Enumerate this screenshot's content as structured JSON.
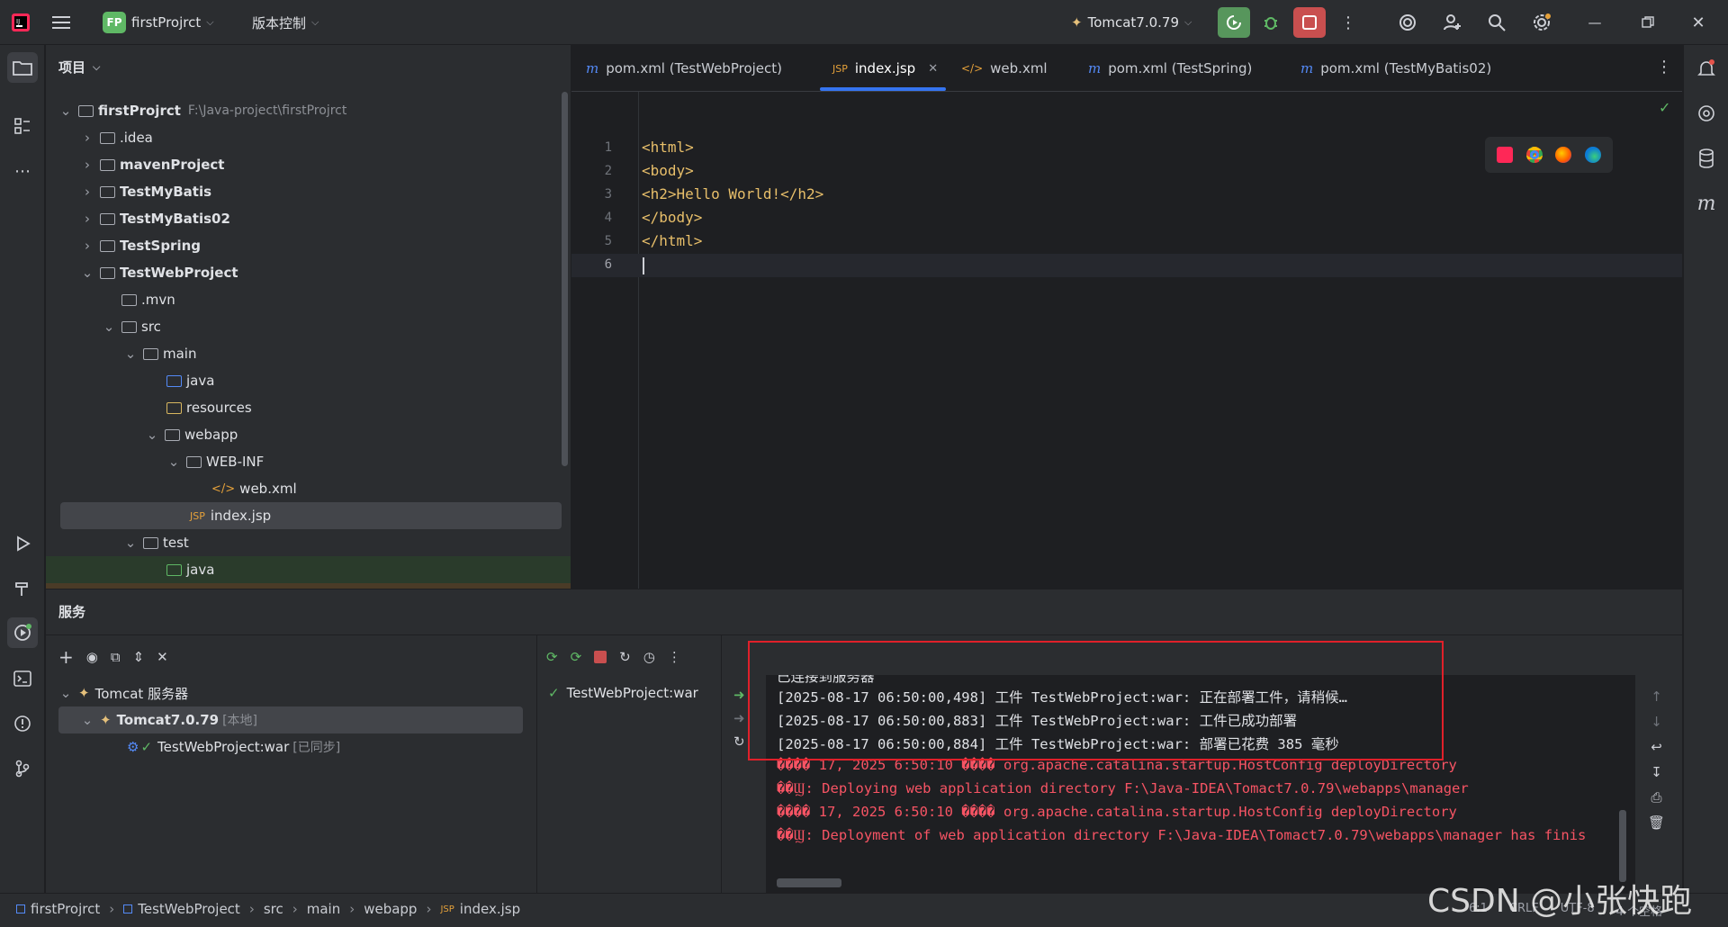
{
  "titlebar": {
    "project_badge": "FP",
    "project_name": "firstProjrct",
    "vcs_menu": "版本控制",
    "run_config": "Tomcat7.0.79"
  },
  "project_panel": {
    "title": "项目",
    "rows": [
      {
        "label": "firstProjrct",
        "path": "F:\\Java-project\\firstProjrct"
      },
      {
        "label": ".idea"
      },
      {
        "label": "mavenProject"
      },
      {
        "label": "TestMyBatis"
      },
      {
        "label": "TestMyBatis02"
      },
      {
        "label": "TestSpring"
      },
      {
        "label": "TestWebProject"
      },
      {
        "label": ".mvn"
      },
      {
        "label": "src"
      },
      {
        "label": "main"
      },
      {
        "label": "java"
      },
      {
        "label": "resources"
      },
      {
        "label": "webapp"
      },
      {
        "label": "WEB-INF"
      },
      {
        "label": "web.xml"
      },
      {
        "label": "index.jsp"
      },
      {
        "label": "test"
      },
      {
        "label": "java"
      }
    ]
  },
  "editor": {
    "tabs": [
      {
        "label": "pom.xml (TestWebProject)"
      },
      {
        "label": "index.jsp"
      },
      {
        "label": "web.xml"
      },
      {
        "label": "pom.xml (TestSpring)"
      },
      {
        "label": "pom.xml (TestMyBatis02)"
      }
    ],
    "lines": [
      {
        "n": "1",
        "code": "<html>"
      },
      {
        "n": "2",
        "code": "<body>"
      },
      {
        "n": "3",
        "code": "<h2>Hello World!</h2>"
      },
      {
        "n": "4",
        "code": "</body>"
      },
      {
        "n": "5",
        "code": "</html>"
      },
      {
        "n": "6",
        "code": ""
      }
    ]
  },
  "services": {
    "title": "服务",
    "tree": {
      "root": "Tomcat 服务器",
      "server": "Tomcat7.0.79",
      "server_tag": "[本地]",
      "artifact": "TestWebProject:war",
      "artifact_tag": "[已同步]"
    },
    "deployment": "TestWebProject:war",
    "log_lines": [
      {
        "text": "已连接到服务器",
        "color": "#dfe1e5"
      },
      {
        "text": "[2025-08-17 06:50:00,498] 工件 TestWebProject:war: 正在部署工件，请稍候…",
        "color": "#dfe1e5"
      },
      {
        "text": "[2025-08-17 06:50:00,883] 工件 TestWebProject:war: 工件已成功部署",
        "color": "#dfe1e5"
      },
      {
        "text": "[2025-08-17 06:50:00,884] 工件 TestWebProject:war: 部署已花费 385 毫秒",
        "color": "#dfe1e5"
      },
      {
        "text": "���� 17, 2025 6:50:10 ���� org.apache.catalina.startup.HostConfig deployDirectory",
        "color": "#f75464"
      },
      {
        "text": "��Ϣ: Deploying web application directory F:\\Java-IDEA\\Tomact7.0.79\\webapps\\manager",
        "color": "#f75464"
      },
      {
        "text": "���� 17, 2025 6:50:10 ���� org.apache.catalina.startup.HostConfig deployDirectory",
        "color": "#f75464"
      },
      {
        "text": "��Ϣ: Deployment of web application directory F:\\Java-IDEA\\Tomact7.0.79\\webapps\\manager has finis",
        "color": "#f75464"
      }
    ]
  },
  "statusbar": {
    "crumbs": [
      "firstProjrct",
      "TestWebProject",
      "src",
      "main",
      "webapp",
      "index.jsp"
    ],
    "line_col": "6:1",
    "line_sep": "CRLF",
    "encoding": "UTF-8",
    "indent": "4 个空格"
  },
  "watermark": "CSDN @小张快跑",
  "colors": {
    "accent": "#3574f0",
    "highlight_box": "#e0202a",
    "run_green": "#57965c",
    "stop_red": "#c94f4f"
  }
}
